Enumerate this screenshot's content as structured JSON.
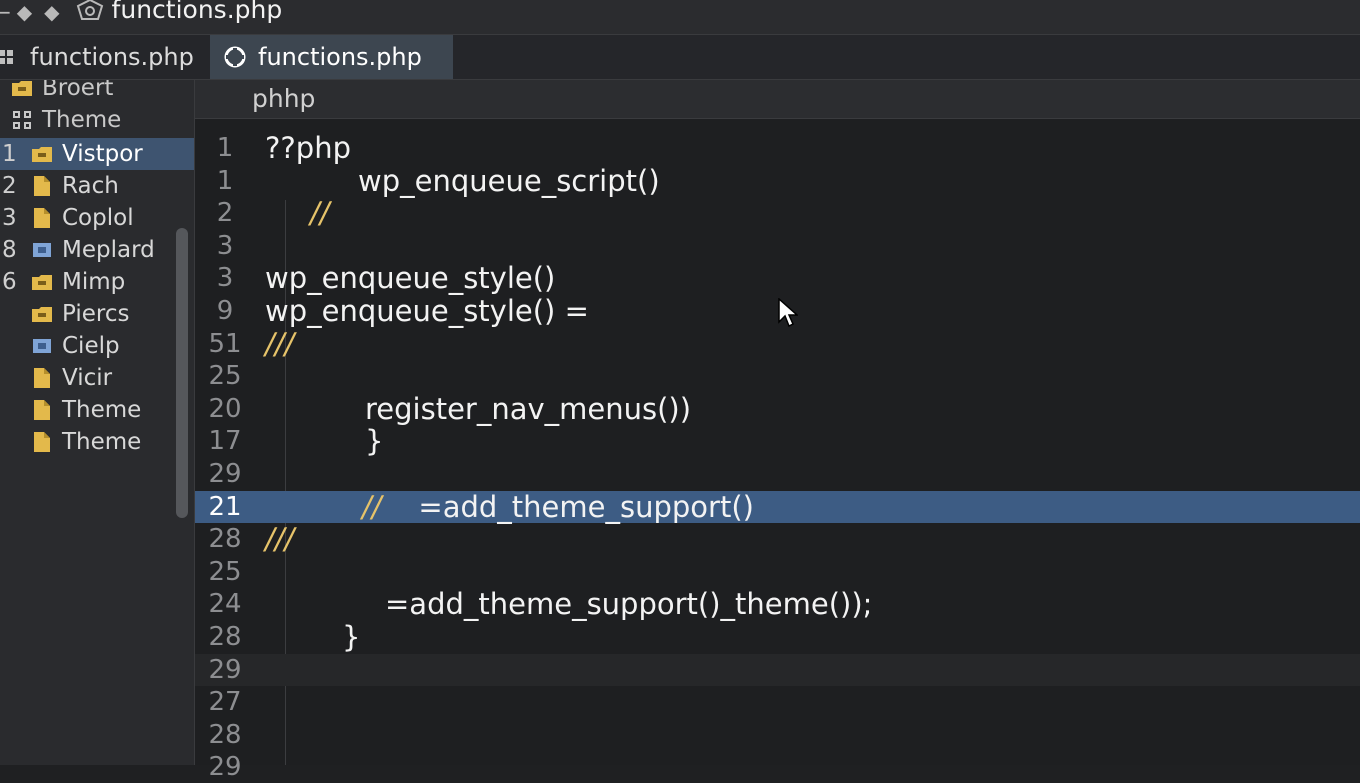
{
  "window": {
    "title": "functions.php"
  },
  "tabs": [
    {
      "label": "functions.php"
    },
    {
      "label": "functions.php"
    }
  ],
  "sidebar": {
    "items": [
      {
        "num": "",
        "label": "Broert",
        "icon": "folder-icon"
      },
      {
        "num": "",
        "label": "Theme",
        "icon": "tree-icon"
      },
      {
        "num": "1",
        "label": "Vistpor",
        "icon": "folder-icon"
      },
      {
        "num": "2",
        "label": "Rach",
        "icon": "file-icon"
      },
      {
        "num": "3",
        "label": "Coplol",
        "icon": "file-icon"
      },
      {
        "num": "8",
        "label": "Meplard",
        "icon": "image-file-icon"
      },
      {
        "num": "6",
        "label": "Mimp",
        "icon": "folder-icon"
      },
      {
        "num": "",
        "label": "Piercs",
        "icon": "folder-icon"
      },
      {
        "num": "",
        "label": "Cielp",
        "icon": "image-file-icon"
      },
      {
        "num": "",
        "label": "Vicir",
        "icon": "file-icon"
      },
      {
        "num": "",
        "label": "Theme",
        "icon": "file-icon"
      },
      {
        "num": "",
        "label": "Theme",
        "icon": "file-icon"
      }
    ]
  },
  "editor": {
    "breadcrumb": "phhp",
    "lines": [
      {
        "n": "1",
        "text": "??php",
        "indent": 0,
        "type": "code"
      },
      {
        "n": "1",
        "text": "wp_enqueue_script()",
        "indent": 1,
        "type": "code"
      },
      {
        "n": "2",
        "text": "//",
        "indent": 2,
        "type": "comment"
      },
      {
        "n": "3",
        "text": "",
        "indent": 0,
        "type": "code"
      },
      {
        "n": "3",
        "text": "wp_enqueue_style()",
        "indent": 3,
        "type": "code"
      },
      {
        "n": "9",
        "text": "wp_enqueue_style() =",
        "indent": 3,
        "type": "code"
      },
      {
        "n": "51",
        "text": "///",
        "indent": 3,
        "type": "comment"
      },
      {
        "n": "25",
        "text": "",
        "indent": 0,
        "type": "code"
      },
      {
        "n": "20",
        "text": "register_nav_menus())",
        "indent": 4,
        "type": "code"
      },
      {
        "n": "17",
        "text": "}",
        "indent": 5,
        "type": "code"
      },
      {
        "n": "29",
        "text": "",
        "indent": 0,
        "type": "code"
      },
      {
        "n": "21",
        "text": "//    =add_theme_support()",
        "indent": 6,
        "type": "mixed",
        "highlight": true
      },
      {
        "n": "28",
        "text": "///",
        "indent": 7,
        "type": "comment"
      },
      {
        "n": "25",
        "text": "",
        "indent": 0,
        "type": "code"
      },
      {
        "n": "24",
        "text": "=add_theme_support()_theme());",
        "indent": 8,
        "type": "code"
      },
      {
        "n": "28",
        "text": "}",
        "indent": 9,
        "type": "code"
      },
      {
        "n": "29",
        "text": "",
        "indent": 0,
        "type": "code",
        "current": true
      },
      {
        "n": "27",
        "text": "",
        "indent": 0,
        "type": "code"
      },
      {
        "n": "28",
        "text": "",
        "indent": 0,
        "type": "code"
      },
      {
        "n": "29",
        "text": "",
        "indent": 0,
        "type": "code"
      }
    ]
  },
  "colors": {
    "selection": "#3d5c84",
    "comment": "#e6c36a",
    "active_tab": "#3d4650"
  }
}
